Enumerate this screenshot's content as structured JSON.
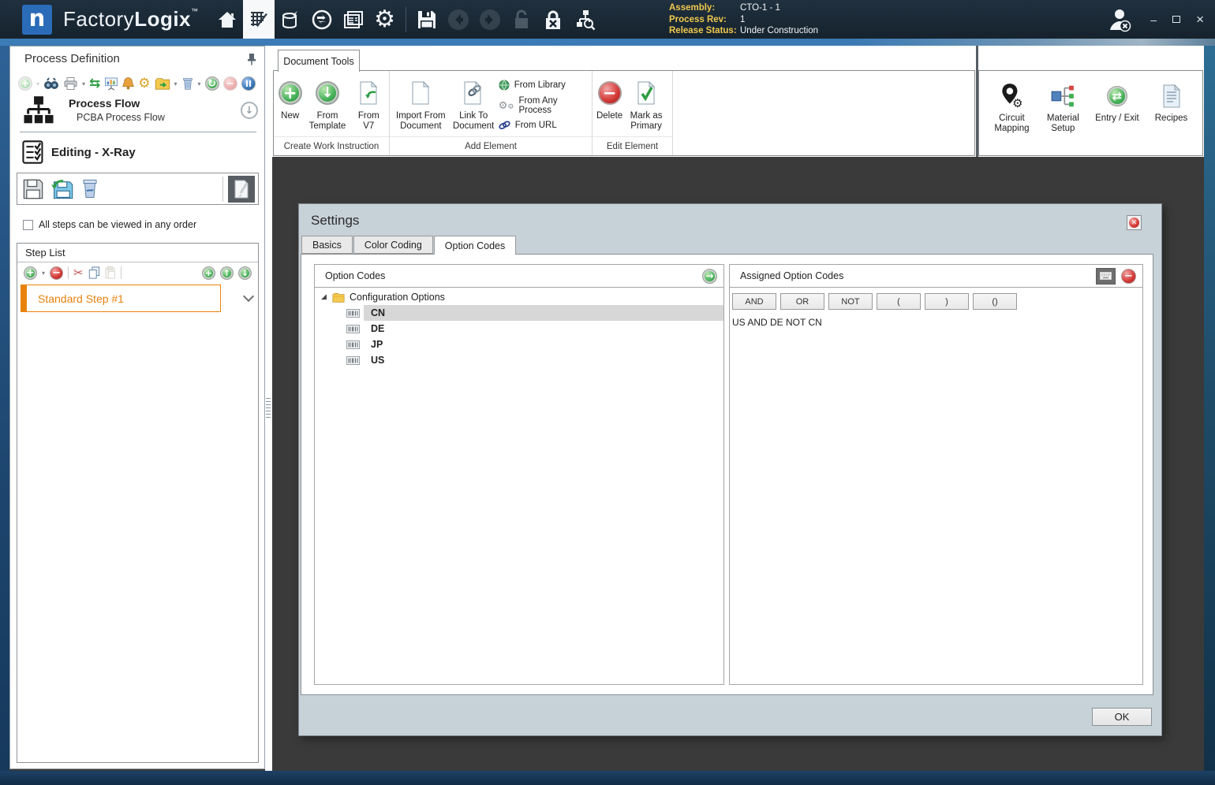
{
  "titlebar": {
    "brand_first": "Factory",
    "brand_second": "Logix",
    "brand_tm": "™",
    "info": [
      {
        "label": "Assembly:",
        "value": "CTO-1 - 1"
      },
      {
        "label": "Process Rev:",
        "value": "1"
      },
      {
        "label": "Release Status:",
        "value": "Under Construction"
      }
    ]
  },
  "sidebar": {
    "title": "Process Definition",
    "process_flow_title": "Process Flow",
    "process_flow_subtitle": "PCBA Process Flow",
    "editing_title": "Editing - X-Ray",
    "order_checkbox_label": "All steps can be viewed in any order",
    "step_list_title": "Step List",
    "steps": [
      {
        "label": "Standard Step #1"
      }
    ]
  },
  "ribbon": {
    "tab": "Document Tools",
    "groups": [
      {
        "label": "Create Work Instruction",
        "items": [
          "New",
          "From Template",
          "From V7"
        ]
      },
      {
        "label": "Add Element",
        "items": [
          "Import From Document",
          "Link To Document"
        ],
        "small_items": [
          "From Library",
          "From Any Process",
          "From URL"
        ]
      },
      {
        "label": "Edit Element",
        "items": [
          "Delete",
          "Mark as Primary"
        ]
      }
    ],
    "right_items": [
      "Circuit Mapping",
      "Material Setup",
      "Entry / Exit",
      "Recipes"
    ]
  },
  "dialog": {
    "title": "Settings",
    "tabs": [
      "Basics",
      "Color Coding",
      "Option Codes"
    ],
    "option_codes_title": "Option Codes",
    "tree_root": "Configuration Options",
    "codes": [
      "CN",
      "DE",
      "JP",
      "US"
    ],
    "selected_code": "CN",
    "assigned_title": "Assigned Option Codes",
    "operators": [
      "AND",
      "OR",
      "NOT",
      "(",
      ")",
      "()"
    ],
    "expression": "US AND DE NOT CN",
    "ok_label": "OK"
  },
  "colors": {
    "accent_orange": "#E8820E",
    "titlebar_bg": "#16232E",
    "highlight_blue": "#3C7CB6",
    "canvas_gray": "#3A3A3A",
    "dialog_bg": "#C7D1D8",
    "label_yellow": "#EFC94C"
  }
}
